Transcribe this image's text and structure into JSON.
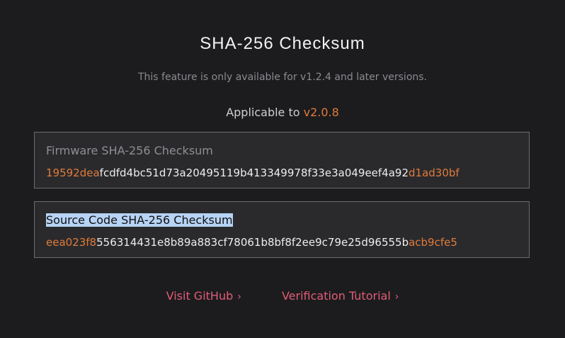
{
  "header": {
    "title": "SHA-256 Checksum",
    "note": "This feature is only available for v1.2.4 and later versions.",
    "applicable_prefix": "Applicable to ",
    "applicable_version": "v2.0.8"
  },
  "checksums": [
    {
      "label": "Firmware SHA-256 Checksum",
      "hash_start": "19592dea",
      "hash_middle": "fcdfd4bc51d73a20495119b413349978f33e3a049eef4a92",
      "hash_end": "d1ad30bf"
    },
    {
      "label": "Source Code SHA-256 Checksum",
      "hash_start": "eea023f8",
      "hash_middle": "556314431e8b89a883cf78061b8bf8f2ee9c79e25d96555b",
      "hash_end": "acb9cfe5"
    }
  ],
  "links": {
    "github": "Visit GitHub",
    "tutorial": "Verification Tutorial",
    "chevron": "›"
  },
  "colors": {
    "background": "#1c1c1f",
    "accent": "#e07b39",
    "link": "#e05d75",
    "selection": "#b7d3f5"
  },
  "icons": {
    "link_chevron": "chevron-right-icon"
  }
}
